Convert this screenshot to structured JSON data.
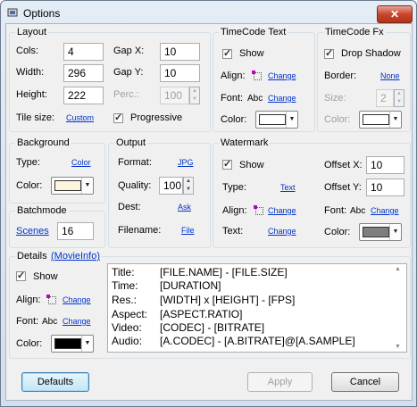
{
  "window": {
    "title": "Options",
    "close_symbol": "✕"
  },
  "layout": {
    "label": "Layout",
    "cols_label": "Cols:",
    "cols_value": "4",
    "width_label": "Width:",
    "width_value": "296",
    "height_label": "Height:",
    "height_value": "222",
    "tile_size_label": "Tile size:",
    "tile_size_link": "Custom",
    "gapx_label": "Gap X:",
    "gapx_value": "10",
    "gapy_label": "Gap Y:",
    "gapy_value": "10",
    "perc_label": "Perc.:",
    "perc_value": "100",
    "progressive_label": "Progressive",
    "progressive_checked": true
  },
  "timecode_text": {
    "label": "TimeCode Text",
    "show_label": "Show",
    "show_checked": true,
    "align_label": "Align:",
    "align_link": "Change",
    "font_label": "Font:",
    "font_sample": "Abc",
    "font_link": "Change",
    "color_label": "Color:",
    "color": "#ffffff"
  },
  "timecode_fx": {
    "label": "TimeCode Fx",
    "drop_shadow_label": "Drop Shadow",
    "drop_shadow_checked": true,
    "border_label": "Border:",
    "border_link": "None",
    "size_label": "Size:",
    "size_value": "2",
    "color_label": "Color:",
    "color": "#ffffff"
  },
  "background": {
    "label": "Background",
    "type_label": "Type:",
    "type_link": "Color",
    "color_label": "Color:",
    "color": "#fdf6dc"
  },
  "output": {
    "label": "Output",
    "format_label": "Format:",
    "format_link": "JPG",
    "quality_label": "Quality:",
    "quality_value": "100",
    "dest_label": "Dest:",
    "dest_link": "Ask",
    "filename_label": "Filename:",
    "filename_link": "File"
  },
  "watermark": {
    "label": "Watermark",
    "show_label": "Show",
    "show_checked": true,
    "type_label": "Type:",
    "type_link": "Text",
    "align_label": "Align:",
    "align_link": "Change",
    "text_label": "Text:",
    "text_link": "Change",
    "offset_x_label": "Offset X:",
    "offset_x_value": "10",
    "offset_y_label": "Offset Y:",
    "offset_y_value": "10",
    "font_label": "Font:",
    "font_sample": "Abc",
    "font_link": "Change",
    "color_label": "Color:",
    "color": "#7f7f7f"
  },
  "batchmode": {
    "label": "Batchmode",
    "scenes_link": "Scenes",
    "scenes_value": "16"
  },
  "details": {
    "label": "Details",
    "movieinfo_link": "(MovieInfo)",
    "show_label": "Show",
    "show_checked": true,
    "align_label": "Align:",
    "align_link": "Change",
    "font_label": "Font:",
    "font_sample": "Abc",
    "font_link": "Change",
    "color_label": "Color:",
    "color": "#000000",
    "lines": [
      {
        "key": "Title:",
        "value": "[FILE.NAME] - [FILE.SIZE]"
      },
      {
        "key": "Time:",
        "value": "[DURATION]"
      },
      {
        "key": "Res.:",
        "value": "[WIDTH] x [HEIGHT] - [FPS]"
      },
      {
        "key": "Aspect:",
        "value": "[ASPECT.RATIO]"
      },
      {
        "key": "Video:",
        "value": "[CODEC] - [BITRATE]"
      },
      {
        "key": "Audio:",
        "value": "[A.CODEC] - [A.BITRATE]@[A.SAMPLE]"
      }
    ]
  },
  "buttons": {
    "defaults": "Defaults",
    "apply": "Apply",
    "cancel": "Cancel"
  }
}
